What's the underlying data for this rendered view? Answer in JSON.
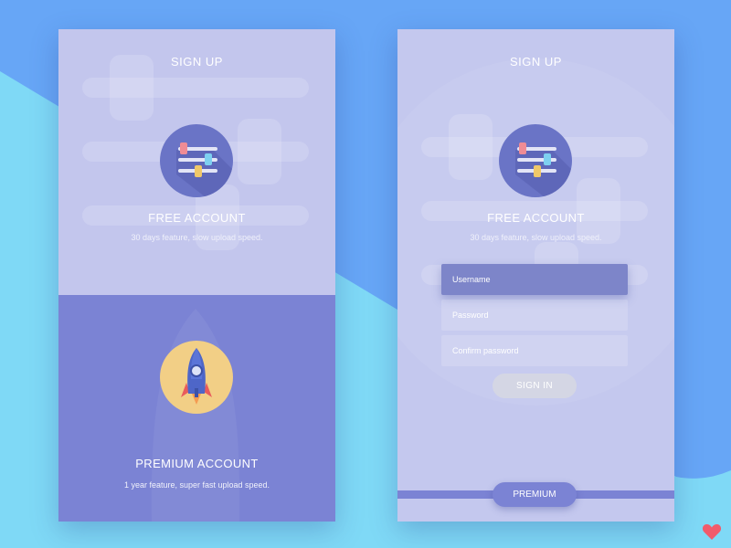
{
  "colors": {
    "background_light": "#7fd9f6",
    "background_blue": "#67a6f6",
    "panel_lavender": "#c3c6ed",
    "premium_purple": "#7b83d4",
    "icon_circle_purple": "#6a74c6",
    "icon_circle_gold": "#f2cf86",
    "heart": "#f15b6c"
  },
  "left_screen": {
    "title": "SIGN UP",
    "free": {
      "icon": "sliders-icon",
      "title": "FREE ACCOUNT",
      "description": "30 days feature, slow upload speed."
    },
    "premium": {
      "icon": "rocket-icon",
      "title": "PREMIUM ACCOUNT",
      "description": "1 year feature, super fast upload speed."
    }
  },
  "right_screen": {
    "title": "SIGN UP",
    "free": {
      "icon": "sliders-icon",
      "title": "FREE ACCOUNT",
      "description": "30 days feature, slow upload speed."
    },
    "form": {
      "username_placeholder": "Username",
      "password_placeholder": "Password",
      "confirm_placeholder": "Confirm password",
      "signin_label": "SIGN IN"
    },
    "premium_label": "PREMIUM"
  },
  "corner_icon": "heart-icon"
}
